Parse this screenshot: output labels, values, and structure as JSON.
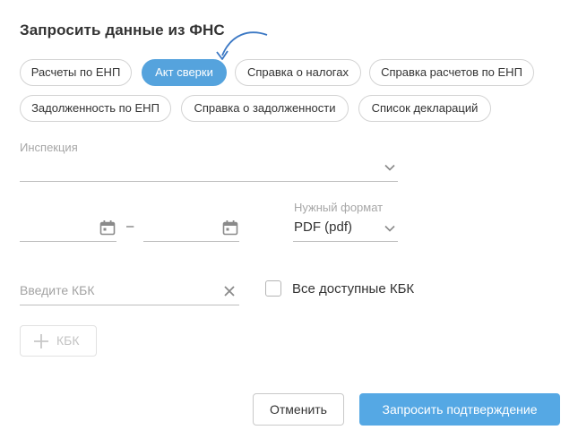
{
  "dialog": {
    "title": "Запросить данные из ФНС"
  },
  "chips": [
    {
      "label": "Расчеты по ЕНП",
      "active": false
    },
    {
      "label": "Акт сверки",
      "active": true
    },
    {
      "label": "Справка о налогах",
      "active": false
    },
    {
      "label": "Справка расчетов по ЕНП",
      "active": false
    },
    {
      "label": "Задолженность по ЕНП",
      "active": false
    },
    {
      "label": "Справка о задолженности",
      "active": false
    },
    {
      "label": "Список деклараций",
      "active": false
    }
  ],
  "inspection": {
    "label": "Инспекция",
    "value": ""
  },
  "period": {
    "separator": "–",
    "from": "",
    "to": ""
  },
  "format": {
    "label": "Нужный формат",
    "value": "PDF (pdf)"
  },
  "kbk": {
    "placeholder": "Введите КБК",
    "all_label": "Все доступные КБК",
    "all_checked": false,
    "add_label": "КБК"
  },
  "actions": {
    "cancel": "Отменить",
    "confirm": "Запросить подтверждение"
  },
  "colors": {
    "accent": "#55a3dd",
    "confirm_bg": "#55a8e4"
  },
  "icons": [
    "arrow-icon",
    "chevron-down-icon",
    "calendar-icon",
    "close-icon",
    "plus-icon"
  ]
}
